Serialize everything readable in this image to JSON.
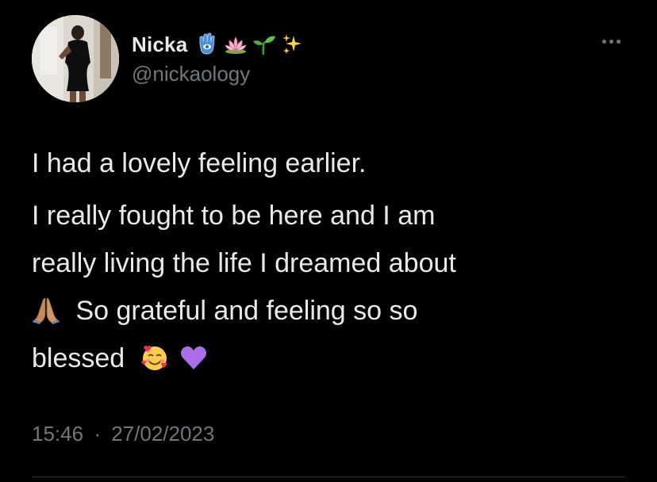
{
  "author": {
    "display_name": "Nicka",
    "handle": "@nickaology",
    "name_emojis": [
      "hamsa-icon",
      "lotus-icon",
      "seedling-icon",
      "sparkles-icon"
    ]
  },
  "tweet": {
    "paragraph1": "I had a lovely feeling earlier.",
    "paragraph2_line1": "I really fought to be here and I am",
    "paragraph2_line2": "really living the life I dreamed about",
    "paragraph2_line3": "So grateful and feeling so so",
    "paragraph2_line4": "blessed",
    "inline_emojis": [
      "folded-hands-icon",
      "smiling-face-with-hearts-icon",
      "purple-heart-icon"
    ]
  },
  "meta": {
    "time": "15:46",
    "separator": "·",
    "date": "27/02/2023"
  },
  "colors": {
    "background": "#000000",
    "primary_text": "#e7e9ea",
    "secondary_text": "#71767b",
    "divider": "#2f3336"
  }
}
